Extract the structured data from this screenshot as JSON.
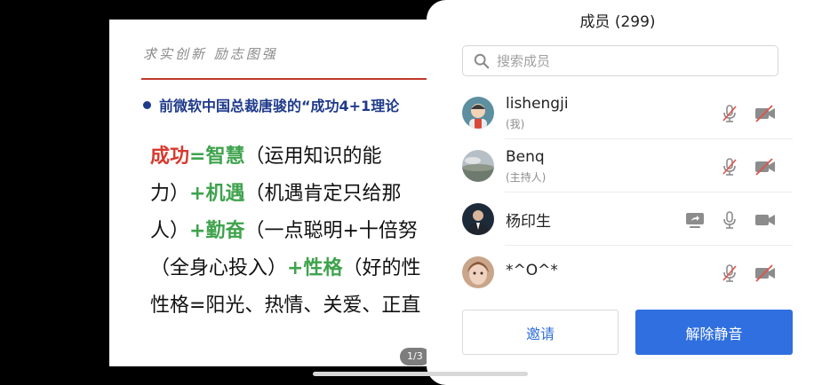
{
  "slide": {
    "motto": "求实创新  励志图强",
    "bullet": "前微软中国总裁唐骏的“成功4+1理论",
    "lines": [
      {
        "a": "成功",
        "b": "=",
        "c": "智慧",
        "d": "（运用知识的能"
      },
      {
        "a": "力）",
        "b": "+机遇",
        "c": "（机遇肯定只给那"
      },
      {
        "a": "人）",
        "b": "+勤奋",
        "c": "（一点聪明+十倍努"
      },
      {
        "a": "（全身心投入）",
        "b": "+性格",
        "c": "（好的性"
      },
      {
        "a": "性格=阳光、热情、关爱、正直"
      }
    ],
    "pager": "1/3"
  },
  "panel": {
    "title": "成员 (299)",
    "search_placeholder": "搜索成员",
    "members": [
      {
        "name": "lishengji",
        "sub": "(我)",
        "mic": "muted",
        "video": "off"
      },
      {
        "name": "Benq",
        "sub": "(主持人)",
        "mic": "muted",
        "video": "off"
      },
      {
        "name": "杨印生",
        "sub": "",
        "mic": "on",
        "video": "on",
        "sharing": true
      },
      {
        "name": "*^O^*",
        "sub": "",
        "mic": "muted",
        "video": "off"
      }
    ],
    "invite_label": "邀请",
    "unmute_all_label": "解除静音"
  },
  "colors": {
    "primary": "#2f6fe0",
    "muted_red": "#e0524a",
    "icon_gray": "#8c8c8c"
  }
}
